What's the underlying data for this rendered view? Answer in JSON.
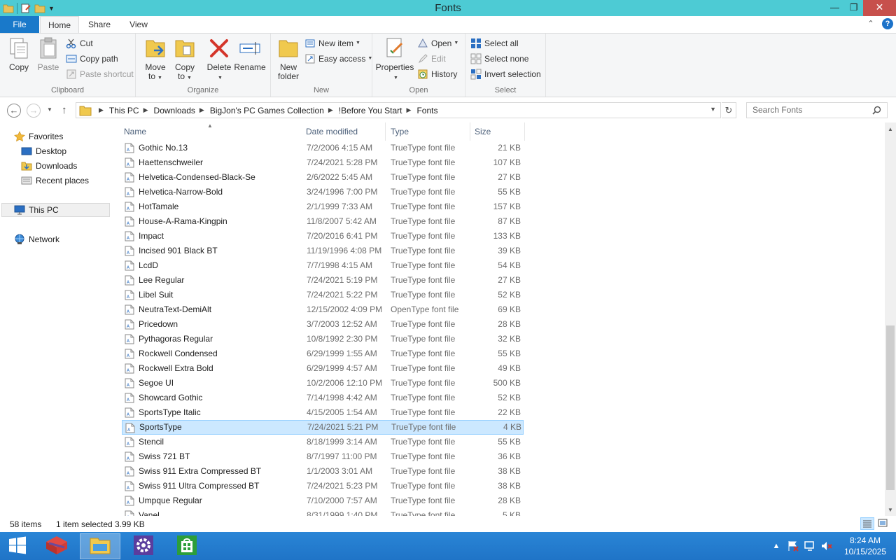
{
  "window": {
    "title": "Fonts"
  },
  "ribbon_tabs": {
    "file": "File",
    "home": "Home",
    "share": "Share",
    "view": "View"
  },
  "ribbon": {
    "clipboard": {
      "label": "Clipboard",
      "copy": "Copy",
      "paste": "Paste",
      "cut": "Cut",
      "copy_path": "Copy path",
      "paste_shortcut": "Paste shortcut"
    },
    "organize": {
      "label": "Organize",
      "move_to_1": "Move",
      "move_to_2": "to",
      "copy_to_1": "Copy",
      "copy_to_2": "to",
      "delete": "Delete",
      "rename": "Rename"
    },
    "new": {
      "label": "New",
      "new_folder_1": "New",
      "new_folder_2": "folder",
      "new_item": "New item",
      "easy_access": "Easy access"
    },
    "open": {
      "label": "Open",
      "properties": "Properties",
      "open": "Open",
      "edit": "Edit",
      "history": "History"
    },
    "select": {
      "label": "Select",
      "select_all": "Select all",
      "select_none": "Select none",
      "invert_selection": "Invert selection"
    }
  },
  "address": {
    "crumbs": [
      "This PC",
      "Downloads",
      "BigJon's PC Games Collection",
      "!Before You Start",
      "Fonts"
    ],
    "search_placeholder": "Search Fonts"
  },
  "nav": {
    "favorites": "Favorites",
    "desktop": "Desktop",
    "downloads": "Downloads",
    "recent_places": "Recent places",
    "this_pc": "This PC",
    "network": "Network"
  },
  "columns": {
    "name": "Name",
    "date": "Date modified",
    "type": "Type",
    "size": "Size"
  },
  "files": [
    {
      "name": "Gothic No.13",
      "date": "7/2/2006 4:15 AM",
      "type": "TrueType font file",
      "size": "21 KB"
    },
    {
      "name": "Haettenschweiler",
      "date": "7/24/2021 5:28 PM",
      "type": "TrueType font file",
      "size": "107 KB"
    },
    {
      "name": "Helvetica-Condensed-Black-Se",
      "date": "2/6/2022 5:45 AM",
      "type": "TrueType font file",
      "size": "27 KB"
    },
    {
      "name": "Helvetica-Narrow-Bold",
      "date": "3/24/1996 7:00 PM",
      "type": "TrueType font file",
      "size": "55 KB"
    },
    {
      "name": "HotTamale",
      "date": "2/1/1999 7:33 AM",
      "type": "TrueType font file",
      "size": "157 KB"
    },
    {
      "name": "House-A-Rama-Kingpin",
      "date": "11/8/2007 5:42 AM",
      "type": "TrueType font file",
      "size": "87 KB"
    },
    {
      "name": "Impact",
      "date": "7/20/2016 6:41 PM",
      "type": "TrueType font file",
      "size": "133 KB"
    },
    {
      "name": "Incised 901 Black BT",
      "date": "11/19/1996 4:08 PM",
      "type": "TrueType font file",
      "size": "39 KB"
    },
    {
      "name": "LcdD",
      "date": "7/7/1998 4:15 AM",
      "type": "TrueType font file",
      "size": "54 KB"
    },
    {
      "name": "Lee Regular",
      "date": "7/24/2021 5:19 PM",
      "type": "TrueType font file",
      "size": "27 KB"
    },
    {
      "name": "Libel Suit",
      "date": "7/24/2021 5:22 PM",
      "type": "TrueType font file",
      "size": "52 KB"
    },
    {
      "name": "NeutraText-DemiAlt",
      "date": "12/15/2002 4:09 PM",
      "type": "OpenType font file",
      "size": "69 KB"
    },
    {
      "name": "Pricedown",
      "date": "3/7/2003 12:52 AM",
      "type": "TrueType font file",
      "size": "28 KB"
    },
    {
      "name": "Pythagoras Regular",
      "date": "10/8/1992 2:30 PM",
      "type": "TrueType font file",
      "size": "32 KB"
    },
    {
      "name": "Rockwell Condensed",
      "date": "6/29/1999 1:55 AM",
      "type": "TrueType font file",
      "size": "55 KB"
    },
    {
      "name": "Rockwell Extra Bold",
      "date": "6/29/1999 4:57 AM",
      "type": "TrueType font file",
      "size": "49 KB"
    },
    {
      "name": "Segoe UI",
      "date": "10/2/2006 12:10 PM",
      "type": "TrueType font file",
      "size": "500 KB"
    },
    {
      "name": "Showcard Gothic",
      "date": "7/14/1998 4:42 AM",
      "type": "TrueType font file",
      "size": "52 KB"
    },
    {
      "name": "SportsType Italic",
      "date": "4/15/2005 1:54 AM",
      "type": "TrueType font file",
      "size": "22 KB"
    },
    {
      "name": "SportsType",
      "date": "7/24/2021 5:21 PM",
      "type": "TrueType font file",
      "size": "4 KB",
      "selected": true
    },
    {
      "name": "Stencil",
      "date": "8/18/1999 3:14 AM",
      "type": "TrueType font file",
      "size": "55 KB"
    },
    {
      "name": "Swiss 721 BT",
      "date": "8/7/1997 11:00 PM",
      "type": "TrueType font file",
      "size": "36 KB"
    },
    {
      "name": "Swiss 911 Extra Compressed BT",
      "date": "1/1/2003 3:01 AM",
      "type": "TrueType font file",
      "size": "38 KB"
    },
    {
      "name": "Swiss 911 Ultra Compressed BT",
      "date": "7/24/2021 5:23 PM",
      "type": "TrueType font file",
      "size": "38 KB"
    },
    {
      "name": "Umpque Regular",
      "date": "7/10/2000 7:57 AM",
      "type": "TrueType font file",
      "size": "28 KB"
    },
    {
      "name": "Vanel",
      "date": "8/31/1999 1:40 PM",
      "type": "TrueType font file",
      "size": "5 KB"
    }
  ],
  "status": {
    "item_count": "58 items",
    "selected": "1 item selected",
    "selected_size": "3.99 KB"
  },
  "taskbar": {
    "time": "8:24 AM",
    "date": "10/15/2025"
  },
  "colors": {
    "titlebar": "#4dcbd4",
    "file_tab": "#1979ca",
    "selection": "#cce8ff",
    "taskbar": "#2a85d6",
    "close_button": "#c7504c"
  },
  "icons": {
    "quick_access": [
      "folder-icon",
      "properties-icon",
      "new-folder-icon"
    ],
    "taskbar": [
      "start-icon",
      "winrar-icon",
      "file-explorer-icon",
      "control-panel-icon",
      "store-icon"
    ]
  }
}
